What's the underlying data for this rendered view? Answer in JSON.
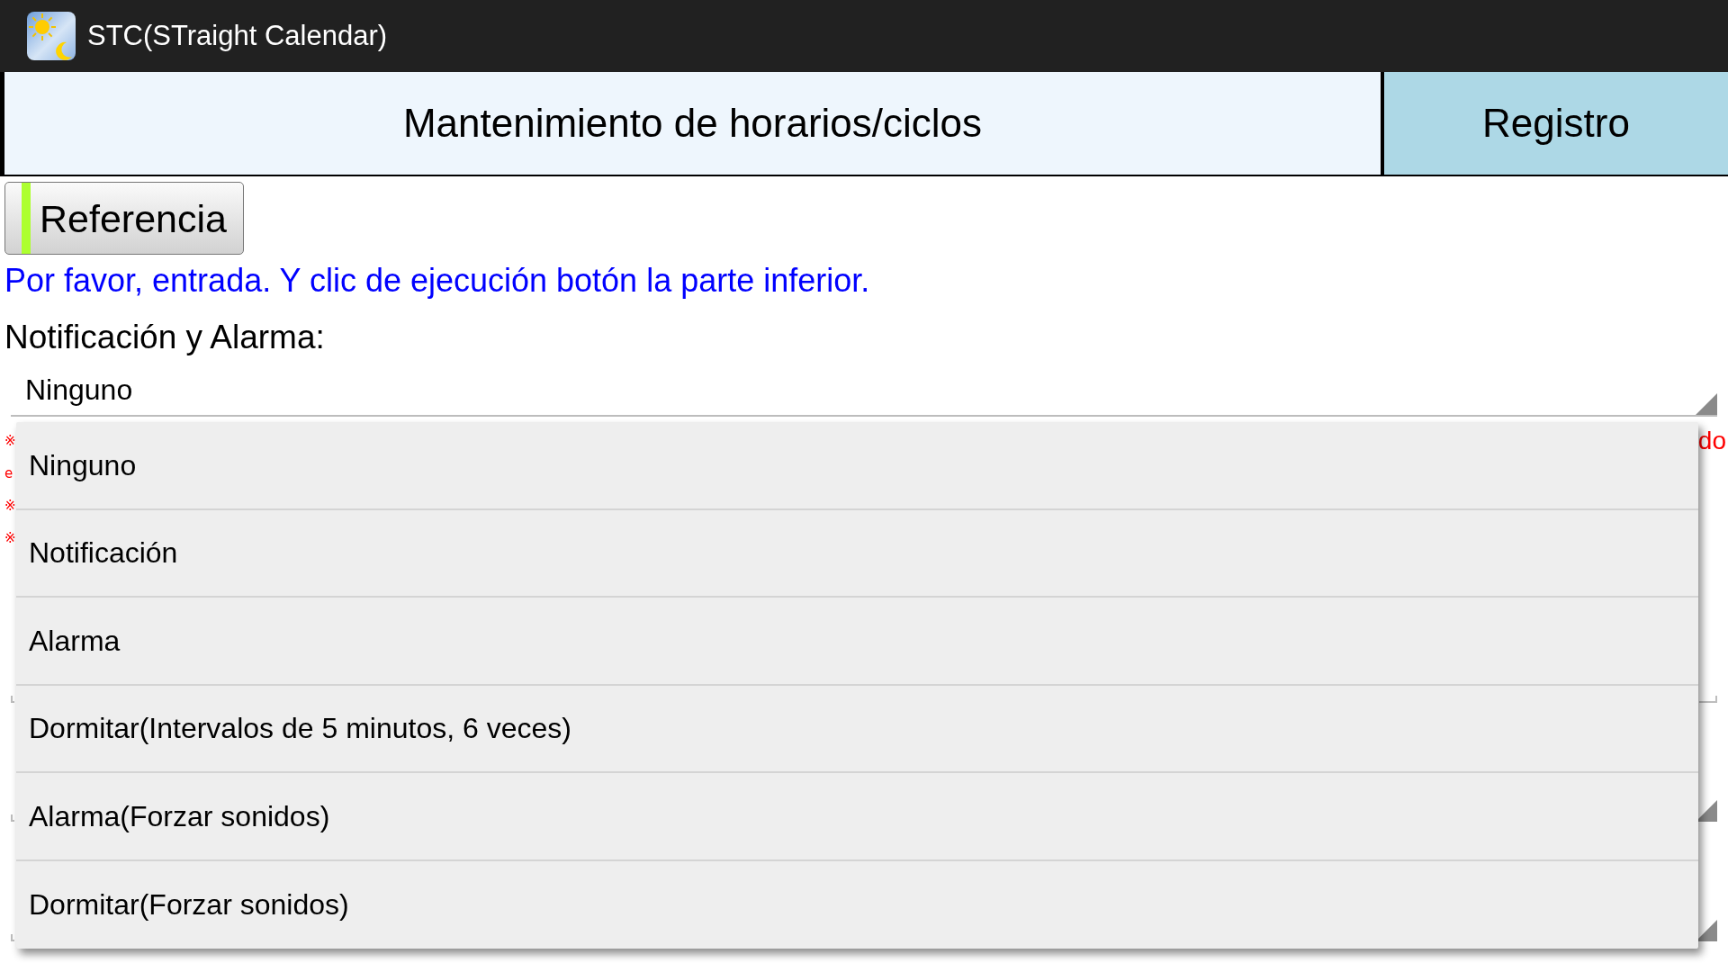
{
  "app_bar": {
    "title": "STC(STraight Calendar)"
  },
  "tabs": [
    {
      "label": "Mantenimiento de horarios/ciclos",
      "selected": true
    },
    {
      "label": "Registro",
      "selected": false
    }
  ],
  "reference_button": {
    "label": "Referencia",
    "on": true
  },
  "instruction": "Por favor, entrada. Y clic de ejecución botón la parte inferior.",
  "notification_field": {
    "label": "Notificación y Alarma:",
    "value": "Ninguno"
  },
  "partly_hidden_notes": {
    "left": [
      "※",
      "e",
      "※",
      "※"
    ],
    "right": [
      "do"
    ]
  },
  "dropdown_list": {
    "items": [
      "Ninguno",
      "Notificación",
      "Alarma",
      "Dormitar(Intervalos de 5 minutos, 6 veces)",
      "Alarma(Forzar sonidos)",
      "Dormitar(Forzar sonidos)"
    ]
  }
}
